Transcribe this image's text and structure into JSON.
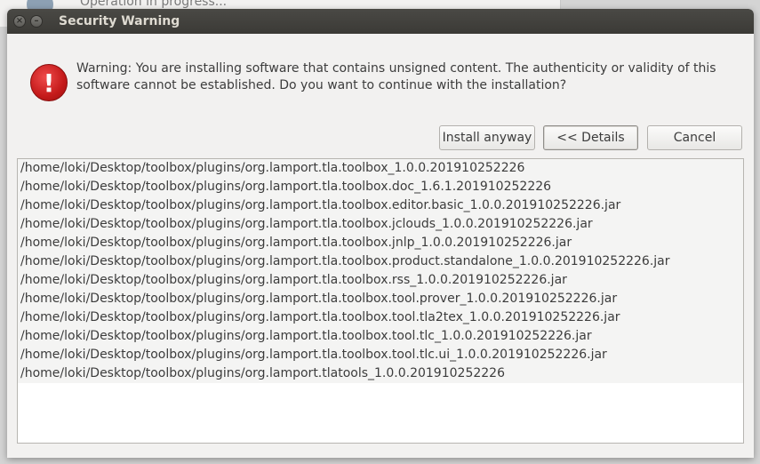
{
  "background": {
    "text": "Operation in progress..."
  },
  "dialog": {
    "title": "Security Warning",
    "warning_symbol": "!",
    "warning_text": "Warning: You are installing software that contains unsigned content. The authenticity or validity of this software cannot be established. Do you want to continue with the installation?",
    "buttons": {
      "install": "Install anyway",
      "details": "<< Details",
      "cancel": "Cancel"
    },
    "titlebar_buttons": {
      "close": "×",
      "minimize": "–"
    },
    "files": [
      "/home/loki/Desktop/toolbox/plugins/org.lamport.tla.toolbox_1.0.0.201910252226",
      "/home/loki/Desktop/toolbox/plugins/org.lamport.tla.toolbox.doc_1.6.1.201910252226",
      "/home/loki/Desktop/toolbox/plugins/org.lamport.tla.toolbox.editor.basic_1.0.0.201910252226.jar",
      "/home/loki/Desktop/toolbox/plugins/org.lamport.tla.toolbox.jclouds_1.0.0.201910252226.jar",
      "/home/loki/Desktop/toolbox/plugins/org.lamport.tla.toolbox.jnlp_1.0.0.201910252226.jar",
      "/home/loki/Desktop/toolbox/plugins/org.lamport.tla.toolbox.product.standalone_1.0.0.201910252226.jar",
      "/home/loki/Desktop/toolbox/plugins/org.lamport.tla.toolbox.rss_1.0.0.201910252226.jar",
      "/home/loki/Desktop/toolbox/plugins/org.lamport.tla.toolbox.tool.prover_1.0.0.201910252226.jar",
      "/home/loki/Desktop/toolbox/plugins/org.lamport.tla.toolbox.tool.tla2tex_1.0.0.201910252226.jar",
      "/home/loki/Desktop/toolbox/plugins/org.lamport.tla.toolbox.tool.tlc_1.0.0.201910252226.jar",
      "/home/loki/Desktop/toolbox/plugins/org.lamport.tla.toolbox.tool.tlc.ui_1.0.0.201910252226.jar",
      "/home/loki/Desktop/toolbox/plugins/org.lamport.tlatools_1.0.0.201910252226"
    ]
  }
}
